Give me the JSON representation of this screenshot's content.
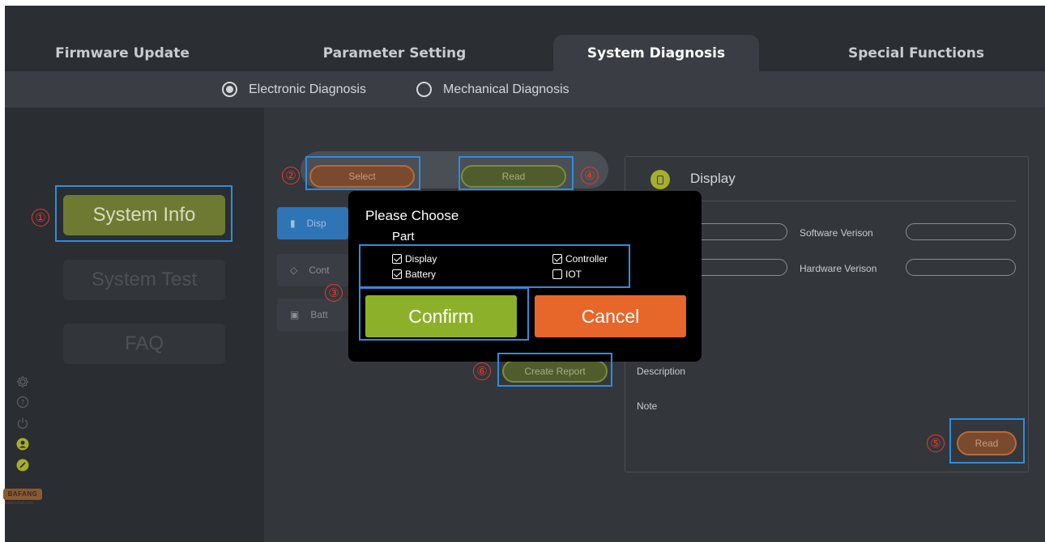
{
  "tabs": [
    {
      "label": "Firmware Update",
      "active": false
    },
    {
      "label": "Parameter Setting",
      "active": false
    },
    {
      "label": "System Diagnosis",
      "active": true
    },
    {
      "label": "Special Functions",
      "active": false
    }
  ],
  "diagnosis_modes": [
    {
      "label": "Electronic Diagnosis",
      "selected": true
    },
    {
      "label": "Mechanical Diagnosis",
      "selected": false
    }
  ],
  "left_nav": [
    {
      "label": "System Info",
      "active": true
    },
    {
      "label": "System Test",
      "active": false
    },
    {
      "label": "FAQ",
      "active": false
    }
  ],
  "sidebar_icons": [
    "settings-icon",
    "help-icon",
    "power-icon",
    "user-icon",
    "link-icon"
  ],
  "brand": {
    "logo": "BAFANG",
    "url": "www.szbaf.com"
  },
  "toolbar": {
    "select_label": "Select",
    "read_label": "Read"
  },
  "parts_list": [
    {
      "label": "Disp",
      "icon": "display-icon"
    },
    {
      "label": "Cont",
      "icon": "controller-icon"
    },
    {
      "label": "Batt",
      "icon": "battery-icon"
    }
  ],
  "create_report_label": "Create Report",
  "info_panel": {
    "title": "Display",
    "software_label": "Software Verison",
    "hardware_label": "Hardware Verison",
    "software_value": "",
    "hardware_value": "",
    "description_label": "Description",
    "note_label": "Note",
    "read_label": "Read"
  },
  "dialog": {
    "title": "Please Choose",
    "subtitle": "Part",
    "options": [
      {
        "label": "Display",
        "checked": true
      },
      {
        "label": "Controller",
        "checked": true
      },
      {
        "label": "Battery",
        "checked": true
      },
      {
        "label": "IOT",
        "checked": false
      }
    ],
    "confirm_label": "Confirm",
    "cancel_label": "Cancel"
  },
  "annotations": [
    "①",
    "②",
    "③",
    "④",
    "⑤",
    "⑥"
  ],
  "colors": {
    "accent_green": "#8db02a",
    "accent_orange": "#e7662a",
    "highlight_blue": "#2e8ce0",
    "annotation_red": "#e83a2a"
  }
}
